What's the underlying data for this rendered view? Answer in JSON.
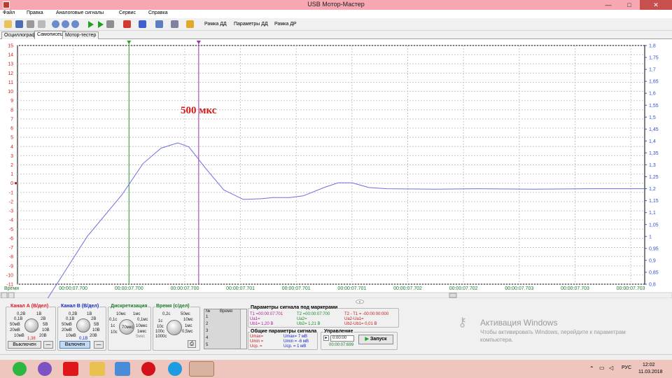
{
  "window": {
    "title": "USB Мотор-Мастер",
    "controls": [
      "—",
      "□",
      "✕"
    ]
  },
  "menu": {
    "items": [
      "Файл",
      "Правка",
      "Аналоговые сигналы",
      "Сервис",
      "Справка"
    ]
  },
  "toolbar": {
    "frame_dd": "Рамка ДД",
    "params_dd": "Параметры ДД",
    "frame_dr": "Рамка ДР",
    "icons": [
      "folder-open-icon",
      "save-icon",
      "print-icon",
      "print-preview-icon",
      "zoom-icon",
      "zoom-in-icon",
      "zoom-fit-icon",
      "play-icon",
      "play-step-icon",
      "stop-icon",
      "signal-a-icon",
      "signal-b-icon",
      "calc-icon",
      "formula-icon",
      "sound-icon"
    ]
  },
  "tabs": [
    {
      "label": "Осциллограф",
      "active": false
    },
    {
      "label": "Самописец",
      "active": true
    },
    {
      "label": "Мотор-тестер",
      "active": false
    }
  ],
  "chart_data": {
    "type": "line",
    "annotation": "500 мкс",
    "left_axis": {
      "range": [
        -11,
        15
      ],
      "ticks": [
        "15",
        "14",
        "13",
        "12",
        "11",
        "10",
        "9",
        "8",
        "7",
        "6",
        "5",
        "4",
        "3",
        "2",
        "1",
        "0",
        "-1",
        "-2",
        "-3",
        "-4",
        "-5",
        "-6",
        "-7",
        "-8",
        "-9",
        "-10",
        "-11"
      ]
    },
    "right_axis": {
      "range": [
        0.8,
        1.8
      ],
      "ticks": [
        "1,8",
        "1,75",
        "1,7",
        "1,65",
        "1,6",
        "1,55",
        "1,5",
        "1,45",
        "1,4",
        "1,35",
        "1,3",
        "1,25",
        "1,2",
        "1,15",
        "1,1",
        "1,05",
        "1",
        "0,95",
        "0,9",
        "0,85",
        "0,8"
      ]
    },
    "x_label": "Время",
    "x_ticks": [
      "00:00:07.700",
      "00:00:07.700",
      "00:00:07.700",
      "00:00:07.701",
      "00:00:07.701",
      "00:00:07.701",
      "00:00:07.702",
      "00:00:07.702",
      "00:00:07.703",
      "00:00:07.703",
      "00:00:07.703",
      "00:00:07.704"
    ],
    "x_time_ms": {
      "start": 7699.7,
      "end": 7704.2,
      "tick_step": 0.4
    },
    "markers": [
      {
        "name": "T1",
        "time_ms": 7700.5,
        "color": "#2ca02c"
      },
      {
        "name": "T2",
        "time_ms": 7701.0,
        "color": "#9b30b0"
      }
    ],
    "series": [
      {
        "color": "#6f6fe0",
        "points_ms_vs_right": [
          [
            7699.85,
            0.68
          ],
          [
            7700.2,
            1.0
          ],
          [
            7700.45,
            1.175
          ],
          [
            7700.6,
            1.305
          ],
          [
            7700.73,
            1.37
          ],
          [
            7700.85,
            1.392
          ],
          [
            7700.93,
            1.375
          ],
          [
            7701.05,
            1.285
          ],
          [
            7701.18,
            1.195
          ],
          [
            7701.32,
            1.155
          ],
          [
            7701.45,
            1.158
          ],
          [
            7701.53,
            1.163
          ],
          [
            7701.65,
            1.163
          ],
          [
            7701.75,
            1.17
          ],
          [
            7701.9,
            1.205
          ],
          [
            7702.0,
            1.225
          ],
          [
            7702.1,
            1.225
          ],
          [
            7702.22,
            1.205
          ],
          [
            7702.35,
            1.2
          ],
          [
            7702.7,
            1.198
          ],
          [
            7703.0,
            1.2
          ],
          [
            7703.4,
            1.198
          ],
          [
            7703.8,
            1.2
          ],
          [
            7704.2,
            1.2
          ]
        ]
      }
    ]
  },
  "channels": {
    "a": {
      "title": "Канал А (В/дел)",
      "labels": [
        "0,2В",
        "1В",
        "0,1В",
        "2В",
        "50мВ",
        "5В",
        "20мВ",
        "10В",
        "10мВ",
        "20В"
      ],
      "value": "1,38",
      "button": "Выключен",
      "color": "#e0141e"
    },
    "b": {
      "title": "Канал В (В/дел)",
      "labels": [
        "0,2В",
        "1В",
        "0,1В",
        "2В",
        "50мВ",
        "5В",
        "20мВ",
        "10В",
        "10мВ",
        "20В"
      ],
      "value": "0,1В",
      "button": "Включен",
      "color": "#1428c8"
    }
  },
  "discretization": {
    "title": "Дискретизация",
    "labels": [
      "10мс",
      "1мс",
      "0,1мс",
      "0,1с",
      "10мкс",
      "1с",
      "1мкс",
      "10с",
      "5мкс"
    ],
    "value": "70мкс"
  },
  "time_div": {
    "title": "Время (с/дел)",
    "labels": [
      "0,2с",
      "50мс",
      "10мс",
      "1с",
      "1мс",
      "10с",
      "100с",
      "0,5мс",
      "1000с"
    ]
  },
  "list": {
    "header_num": "№",
    "header_time": "Время",
    "rows": [
      "1",
      "2",
      "3",
      "4",
      "5"
    ]
  },
  "marker_params": {
    "title": "Параметры сигнала под маркерами",
    "t1": "T1 =00:00:07:701",
    "u_a1": "Ua1=",
    "u_b1": "Ub1= 1,20 В",
    "t2": "T2 =00:00:07:700",
    "u_a2": "Ua2=",
    "u_b2": "Ub2= 1,21 В",
    "dt": "T2 - T1 = -00:00:00:000",
    "du_a": "Ua2-Ua1=",
    "du_b": "Ub2-Ub1= 0,01 В"
  },
  "general_params": {
    "title": "Общие параметры сигнала",
    "umax": "Umax=",
    "umin": "Umin =",
    "ucp": "Uср. =",
    "umax_b": "Umax= 7 мВ",
    "umin_b": "Umin = -6 мВ",
    "ucp_b": "Uср. = 1 мВ"
  },
  "control": {
    "title": "Управление",
    "time_value": "0:00:00",
    "elapsed": "00:00:07:699",
    "start_button": "Запуск"
  },
  "watermark": {
    "title": "Активация Windows",
    "line1": "Чтобы активировать Windows, перейдите к параметрам",
    "line2": "компьютера."
  },
  "taskbar": {
    "apps": [
      "whatsapp-icon",
      "viber-icon",
      "yandex-icon",
      "explorer-icon",
      "control-panel-icon",
      "opera-icon",
      "skype-icon",
      "motor-master-icon"
    ],
    "lang": "РУС",
    "time": "12:02",
    "date": "11.03.2018"
  }
}
